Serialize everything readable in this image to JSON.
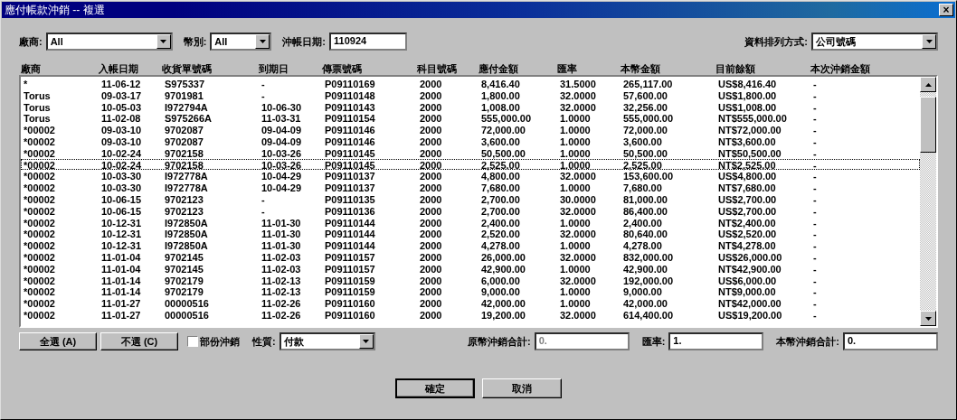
{
  "window": {
    "title": "應付帳款沖銷 -- 複選",
    "close": "×"
  },
  "filters": [
    {
      "label": "廠商:",
      "value": "All",
      "kind": "combo"
    },
    {
      "label": "幣別:",
      "value": "All",
      "kind": "combo"
    },
    {
      "label": "沖帳日期:",
      "value": "110924",
      "kind": "text"
    }
  ],
  "sort": {
    "label": "資料排列方式:",
    "value": "公司號碼"
  },
  "columns": [
    "廠商",
    "入帳日期",
    "收貨單號碼",
    "到期日",
    "傳票號碼",
    "科目號碼",
    "應付金額",
    "匯率",
    "本幣金額",
    "目前餘額",
    "本次沖銷金額"
  ],
  "rows": [
    {
      "focused": false,
      "cells": [
        "*",
        "11-06-12",
        "S975337",
        "-",
        "P09110169",
        "2000",
        "8,416.40",
        "31.5000",
        "265,117.00",
        "US$8,416.40",
        "-"
      ]
    },
    {
      "focused": false,
      "cells": [
        "Torus",
        "09-03-17",
        "9701981",
        "-",
        "P09110148",
        "2000",
        "1,800.00",
        "32.0000",
        "57,600.00",
        "US$1,800.00",
        "-"
      ]
    },
    {
      "focused": false,
      "cells": [
        "Torus",
        "10-05-03",
        "I972794A",
        "10-06-30",
        "P09110143",
        "2000",
        "1,008.00",
        "32.0000",
        "32,256.00",
        "US$1,008.00",
        "-"
      ]
    },
    {
      "focused": false,
      "cells": [
        "Torus",
        "11-02-08",
        "S975266A",
        "11-03-31",
        "P09110154",
        "2000",
        "555,000.00",
        "1.0000",
        "555,000.00",
        "NT$555,000.00",
        "-"
      ]
    },
    {
      "focused": false,
      "cells": [
        "*00002",
        "09-03-10",
        "9702087",
        "09-04-09",
        "P09110146",
        "2000",
        "72,000.00",
        "1.0000",
        "72,000.00",
        "NT$72,000.00",
        "-"
      ]
    },
    {
      "focused": false,
      "cells": [
        "*00002",
        "09-03-10",
        "9702087",
        "09-04-09",
        "P09110146",
        "2000",
        "3,600.00",
        "1.0000",
        "3,600.00",
        "NT$3,600.00",
        "-"
      ]
    },
    {
      "focused": false,
      "cells": [
        "*00002",
        "10-02-24",
        "9702158",
        "10-03-26",
        "P09110145",
        "2000",
        "50,500.00",
        "1.0000",
        "50,500.00",
        "NT$50,500.00",
        "-"
      ]
    },
    {
      "focused": true,
      "cells": [
        "*00002",
        "10-02-24",
        "9702158",
        "10-03-26",
        "P09110145",
        "2000",
        "2,525.00",
        "1.0000",
        "2,525.00",
        "NT$2,525.00",
        "-"
      ]
    },
    {
      "focused": false,
      "cells": [
        "*00002",
        "10-03-30",
        "I972778A",
        "10-04-29",
        "P09110137",
        "2000",
        "4,800.00",
        "32.0000",
        "153,600.00",
        "US$4,800.00",
        "-"
      ]
    },
    {
      "focused": false,
      "cells": [
        "*00002",
        "10-03-30",
        "I972778A",
        "10-04-29",
        "P09110137",
        "2000",
        "7,680.00",
        "1.0000",
        "7,680.00",
        "NT$7,680.00",
        "-"
      ]
    },
    {
      "focused": false,
      "cells": [
        "*00002",
        "10-06-15",
        "9702123",
        "-",
        "P09110135",
        "2000",
        "2,700.00",
        "30.0000",
        "81,000.00",
        "US$2,700.00",
        "-"
      ]
    },
    {
      "focused": false,
      "cells": [
        "*00002",
        "10-06-15",
        "9702123",
        "-",
        "P09110136",
        "2000",
        "2,700.00",
        "32.0000",
        "86,400.00",
        "US$2,700.00",
        "-"
      ]
    },
    {
      "focused": false,
      "cells": [
        "*00002",
        "10-12-31",
        "I972850A",
        "11-01-30",
        "P09110144",
        "2000",
        "2,400.00",
        "1.0000",
        "2,400.00",
        "NT$2,400.00",
        "-"
      ]
    },
    {
      "focused": false,
      "cells": [
        "*00002",
        "10-12-31",
        "I972850A",
        "11-01-30",
        "P09110144",
        "2000",
        "2,520.00",
        "32.0000",
        "80,640.00",
        "US$2,520.00",
        "-"
      ]
    },
    {
      "focused": false,
      "cells": [
        "*00002",
        "10-12-31",
        "I972850A",
        "11-01-30",
        "P09110144",
        "2000",
        "4,278.00",
        "1.0000",
        "4,278.00",
        "NT$4,278.00",
        "-"
      ]
    },
    {
      "focused": false,
      "cells": [
        "*00002",
        "11-01-04",
        "9702145",
        "11-02-03",
        "P09110157",
        "2000",
        "26,000.00",
        "32.0000",
        "832,000.00",
        "US$26,000.00",
        "-"
      ]
    },
    {
      "focused": false,
      "cells": [
        "*00002",
        "11-01-04",
        "9702145",
        "11-02-03",
        "P09110157",
        "2000",
        "42,900.00",
        "1.0000",
        "42,900.00",
        "NT$42,900.00",
        "-"
      ]
    },
    {
      "focused": false,
      "cells": [
        "*00002",
        "11-01-14",
        "9702179",
        "11-02-13",
        "P09110159",
        "2000",
        "6,000.00",
        "32.0000",
        "192,000.00",
        "US$6,000.00",
        "-"
      ]
    },
    {
      "focused": false,
      "cells": [
        "*00002",
        "11-01-14",
        "9702179",
        "11-02-13",
        "P09110159",
        "2000",
        "9,000.00",
        "1.0000",
        "9,000.00",
        "NT$9,000.00",
        "-"
      ]
    },
    {
      "focused": false,
      "cells": [
        "*00002",
        "11-01-27",
        "00000516",
        "11-02-26",
        "P09110160",
        "2000",
        "42,000.00",
        "1.0000",
        "42,000.00",
        "NT$42,000.00",
        "-"
      ]
    },
    {
      "focused": false,
      "cells": [
        "*00002",
        "11-01-27",
        "00000516",
        "11-02-26",
        "P09110160",
        "2000",
        "19,200.00",
        "32.0000",
        "614,400.00",
        "US$19,200.00",
        "-"
      ]
    }
  ],
  "actions": {
    "select_all": "全選 (A)",
    "deselect": "不選 (C)",
    "partial": {
      "label": "部份沖銷",
      "checked": false
    },
    "nature": {
      "label": "性質:",
      "value": "付款"
    }
  },
  "totals": [
    {
      "label": "原幣沖銷合計:",
      "value": "0.",
      "disabled": true
    },
    {
      "label": "匯率:",
      "value": "1.",
      "disabled": false
    },
    {
      "label": "本幣沖銷合計:",
      "value": "0.",
      "disabled": false
    }
  ],
  "buttons": [
    "確定",
    "取消"
  ]
}
